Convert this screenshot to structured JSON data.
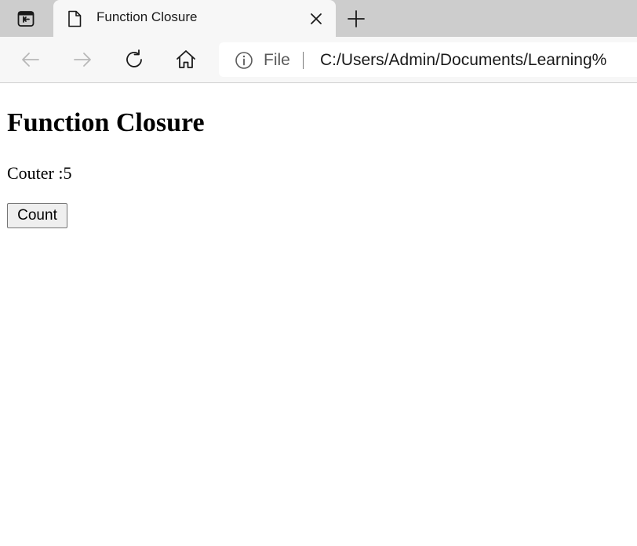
{
  "browser": {
    "tab": {
      "title": "Function Closure",
      "favicon": "page-icon",
      "close_icon": "close-icon"
    },
    "new_tab_icon": "plus-icon",
    "tab_actions_icon": "tab-actions-icon",
    "toolbar": {
      "back_icon": "back-arrow-icon",
      "forward_icon": "forward-arrow-icon",
      "refresh_icon": "refresh-icon",
      "home_icon": "home-icon"
    },
    "address_bar": {
      "info_icon": "info-icon",
      "scheme": "File",
      "url": "C:/Users/Admin/Documents/Learning%"
    }
  },
  "page": {
    "heading": "Function Closure",
    "counter_text": "Couter :5",
    "count_button_label": "Count"
  },
  "colors": {
    "tabstrip": "#cdcdcd",
    "toolbar": "#f7f7f7",
    "button_bg": "#efefef"
  }
}
